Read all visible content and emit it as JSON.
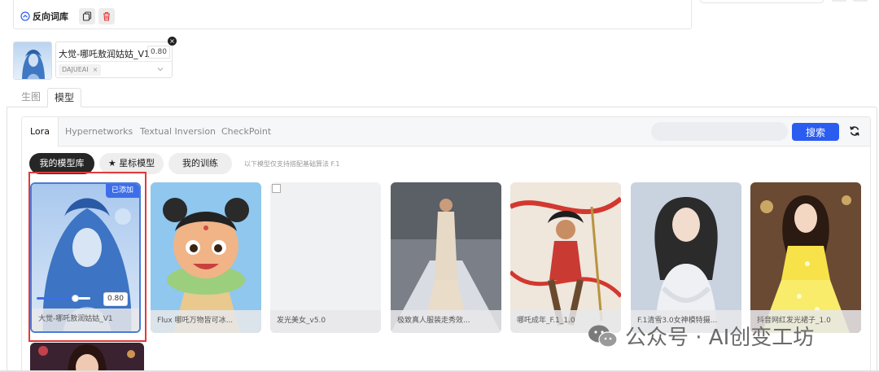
{
  "prompt": {
    "reverse_label": "反向词库"
  },
  "selected_lora": {
    "name": "大觉-哪吒敖润姑姑_V1",
    "weight": "0.80",
    "tag": "DAJUEAI",
    "tag_remove": "×",
    "close": "×"
  },
  "outer_tabs": [
    {
      "label": "生图"
    },
    {
      "label": "模型"
    }
  ],
  "inner_tabs": [
    {
      "label": "Lora"
    },
    {
      "label": "Hypernetworks"
    },
    {
      "label": "Textual Inversion"
    },
    {
      "label": "CheckPoint"
    }
  ],
  "search": {
    "placeholder": "",
    "button_label": "搜索"
  },
  "filters": {
    "my_library": "我的模型库",
    "starred": "星标模型",
    "starred_icon": "★",
    "my_training": "我的训练",
    "note": "以下模型仅支持搭配基础算法 F.1"
  },
  "cards": [
    {
      "label": "大觉-哪吒敖润姑姑_V1",
      "badge": "已添加",
      "weight": "0.80",
      "weight_fraction": 0.72
    },
    {
      "label": "Flux 哪吒万物皆可冰..."
    },
    {
      "label": "发光美女_v5.0"
    },
    {
      "label": "极致真人服装走秀效..."
    },
    {
      "label": "哪吒成年_F.1_1.0"
    },
    {
      "label": "F.1清雪3.0女神模特摄..."
    },
    {
      "label": "抖音网红发光裙子_1.0"
    }
  ],
  "watermark": "公众号 · AI创变工坊",
  "colors": {
    "primary": "#2b5cf0",
    "badge": "#3d6ee8",
    "highlight_frame": "#e23a3a",
    "delete": "#e23a3a"
  }
}
